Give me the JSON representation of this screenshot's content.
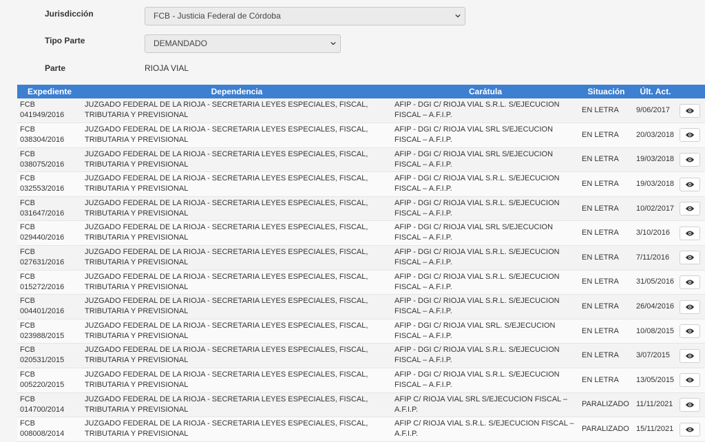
{
  "filters": {
    "jurisdiccion_label": "Jurisdicción",
    "jurisdiccion_value": "FCB - Justicia Federal de Córdoba",
    "tipo_parte_label": "Tipo Parte",
    "tipo_parte_value": "DEMANDADO",
    "parte_label": "Parte",
    "parte_value": "RIOJA VIAL"
  },
  "table": {
    "headers": {
      "expediente": "Expediente",
      "dependencia": "Dependencia",
      "caratula": "Carátula",
      "situacion": "Situación",
      "ult_act": "Últ. Act."
    },
    "rows": [
      {
        "expediente": "FCB 041949/2016",
        "dependencia": "JUZGADO FEDERAL DE LA RIOJA - SECRETARIA LEYES ESPECIALES, FISCAL, TRIBUTARIA Y PREVISIONAL",
        "caratula": "AFIP - DGI C/ RIOJA VIAL S.R.L. S/EJECUCION FISCAL – A.F.I.P.",
        "situacion": "EN LETRA",
        "ult_act": "9/06/2017"
      },
      {
        "expediente": "FCB 038304/2016",
        "dependencia": "JUZGADO FEDERAL DE LA RIOJA - SECRETARIA LEYES ESPECIALES, FISCAL, TRIBUTARIA Y PREVISIONAL",
        "caratula": "AFIP - DGI C/ RIOJA VIAL SRL S/EJECUCION FISCAL – A.F.I.P.",
        "situacion": "EN LETRA",
        "ult_act": "20/03/2018"
      },
      {
        "expediente": "FCB 038075/2016",
        "dependencia": "JUZGADO FEDERAL DE LA RIOJA - SECRETARIA LEYES ESPECIALES, FISCAL, TRIBUTARIA Y PREVISIONAL",
        "caratula": "AFIP - DGI C/ RIOJA VIAL SRL S/EJECUCION FISCAL – A.F.I.P.",
        "situacion": "EN LETRA",
        "ult_act": "19/03/2018"
      },
      {
        "expediente": "FCB 032553/2016",
        "dependencia": "JUZGADO FEDERAL DE LA RIOJA - SECRETARIA LEYES ESPECIALES, FISCAL, TRIBUTARIA Y PREVISIONAL",
        "caratula": "AFIP - DGI C/ RIOJA VIAL S.R.L. S/EJECUCION FISCAL – A.F.I.P.",
        "situacion": "EN LETRA",
        "ult_act": "19/03/2018"
      },
      {
        "expediente": "FCB 031647/2016",
        "dependencia": "JUZGADO FEDERAL DE LA RIOJA - SECRETARIA LEYES ESPECIALES, FISCAL, TRIBUTARIA Y PREVISIONAL",
        "caratula": "AFIP - DGI C/ RIOJA VIAL S.R.L. S/EJECUCION FISCAL – A.F.I.P.",
        "situacion": "EN LETRA",
        "ult_act": "10/02/2017"
      },
      {
        "expediente": "FCB 029440/2016",
        "dependencia": "JUZGADO FEDERAL DE LA RIOJA - SECRETARIA LEYES ESPECIALES, FISCAL, TRIBUTARIA Y PREVISIONAL",
        "caratula": "AFIP - DGI C/ RIOJA VIAL SRL S/EJECUCION FISCAL – A.F.I.P.",
        "situacion": "EN LETRA",
        "ult_act": "3/10/2016"
      },
      {
        "expediente": "FCB 027631/2016",
        "dependencia": "JUZGADO FEDERAL DE LA RIOJA - SECRETARIA LEYES ESPECIALES, FISCAL, TRIBUTARIA Y PREVISIONAL",
        "caratula": "AFIP - DGI C/ RIOJA VIAL S.R.L. S/EJECUCION FISCAL – A.F.I.P.",
        "situacion": "EN LETRA",
        "ult_act": "7/11/2016"
      },
      {
        "expediente": "FCB 015272/2016",
        "dependencia": "JUZGADO FEDERAL DE LA RIOJA - SECRETARIA LEYES ESPECIALES, FISCAL, TRIBUTARIA Y PREVISIONAL",
        "caratula": "AFIP - DGI C/ RIOJA VIAL S.R.L. S/EJECUCION FISCAL – A.F.I.P.",
        "situacion": "EN LETRA",
        "ult_act": "31/05/2016"
      },
      {
        "expediente": "FCB 004401/2016",
        "dependencia": "JUZGADO FEDERAL DE LA RIOJA - SECRETARIA LEYES ESPECIALES, FISCAL, TRIBUTARIA Y PREVISIONAL",
        "caratula": "AFIP - DGI C/ RIOJA VIAL S.R.L. S/EJECUCION FISCAL – A.F.I.P.",
        "situacion": "EN LETRA",
        "ult_act": "26/04/2016"
      },
      {
        "expediente": "FCB 023988/2015",
        "dependencia": "JUZGADO FEDERAL DE LA RIOJA - SECRETARIA LEYES ESPECIALES, FISCAL, TRIBUTARIA Y PREVISIONAL",
        "caratula": "AFIP - DGI C/ RIOJA VIAL SRL. S/EJECUCION FISCAL – A.F.I.P.",
        "situacion": "EN LETRA",
        "ult_act": "10/08/2015"
      },
      {
        "expediente": "FCB 020531/2015",
        "dependencia": "JUZGADO FEDERAL DE LA RIOJA - SECRETARIA LEYES ESPECIALES, FISCAL, TRIBUTARIA Y PREVISIONAL",
        "caratula": "AFIP - DGI C/ RIOJA VIAL S.R.L. S/EJECUCION FISCAL – A.F.I.P.",
        "situacion": "EN LETRA",
        "ult_act": "3/07/2015"
      },
      {
        "expediente": "FCB 005220/2015",
        "dependencia": "JUZGADO FEDERAL DE LA RIOJA - SECRETARIA LEYES ESPECIALES, FISCAL, TRIBUTARIA Y PREVISIONAL",
        "caratula": "AFIP - DGI C/ RIOJA VIAL S.R.L. S/EJECUCION FISCAL – A.F.I.P.",
        "situacion": "EN LETRA",
        "ult_act": "13/05/2015"
      },
      {
        "expediente": "FCB 014700/2014",
        "dependencia": "JUZGADO FEDERAL DE LA RIOJA - SECRETARIA LEYES ESPECIALES, FISCAL, TRIBUTARIA Y PREVISIONAL",
        "caratula": "AFIP C/ RIOJA VIAL SRL S/EJECUCION FISCAL – A.F.I.P.",
        "situacion": "PARALIZADO",
        "ult_act": "11/11/2021"
      },
      {
        "expediente": "FCB 008008/2014",
        "dependencia": "JUZGADO FEDERAL DE LA RIOJA - SECRETARIA LEYES ESPECIALES, FISCAL, TRIBUTARIA Y PREVISIONAL",
        "caratula": "AFIP C/ RIOJA VIAL S.R.L. S/EJECUCION FISCAL – A.F.I.P.",
        "situacion": "PARALIZADO",
        "ult_act": "15/11/2021"
      }
    ]
  },
  "icons": {
    "row_action": "eye-icon",
    "select_toggle": "chevron-down-icon"
  }
}
